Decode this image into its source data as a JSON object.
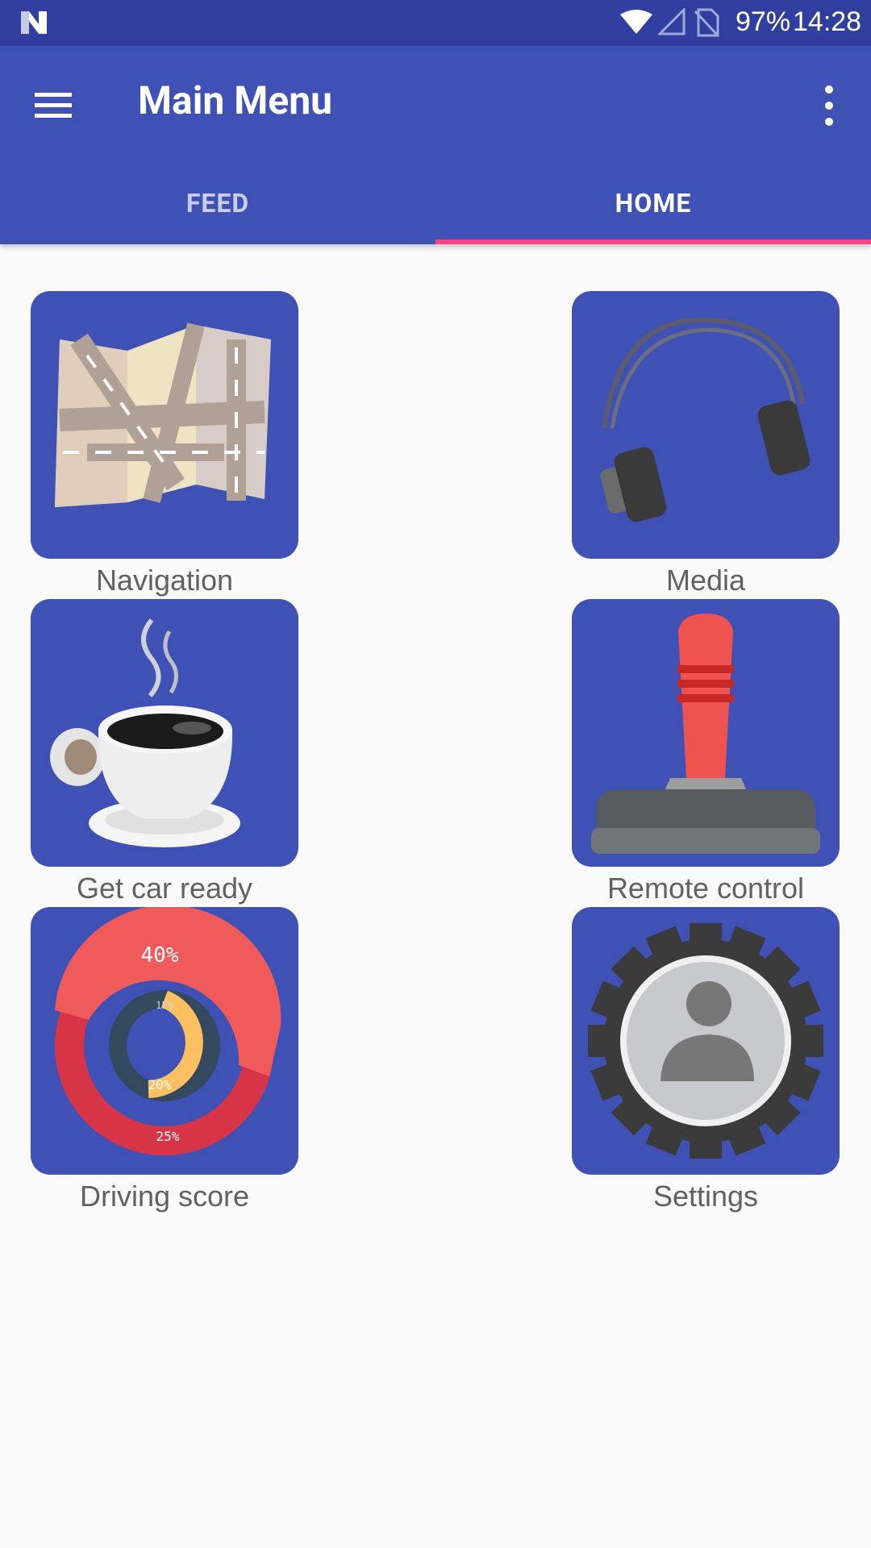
{
  "status_bar": {
    "battery": "97%",
    "time": "14:28"
  },
  "app_bar": {
    "title": "Main Menu",
    "tabs": [
      {
        "label": "FEED",
        "active": false
      },
      {
        "label": "HOME",
        "active": true
      }
    ]
  },
  "colors": {
    "primary": "#3f51b5",
    "primary_dark": "#303f9f",
    "accent": "#ff4081",
    "background": "#fafafa",
    "label_text": "#616161"
  },
  "tiles": [
    {
      "label": "Navigation",
      "icon": "map-icon"
    },
    {
      "label": "Media",
      "icon": "headphones-icon"
    },
    {
      "label": "Get car ready",
      "icon": "coffee-cup-icon"
    },
    {
      "label": "Remote control",
      "icon": "joystick-icon"
    },
    {
      "label": "Driving score",
      "icon": "donut-chart-icon",
      "chart_text": {
        "outer": "40%",
        "inner_top": "15%",
        "inner_bottom": "20%",
        "bottom": "25%"
      }
    },
    {
      "label": "Settings",
      "icon": "gear-profile-icon"
    }
  ]
}
